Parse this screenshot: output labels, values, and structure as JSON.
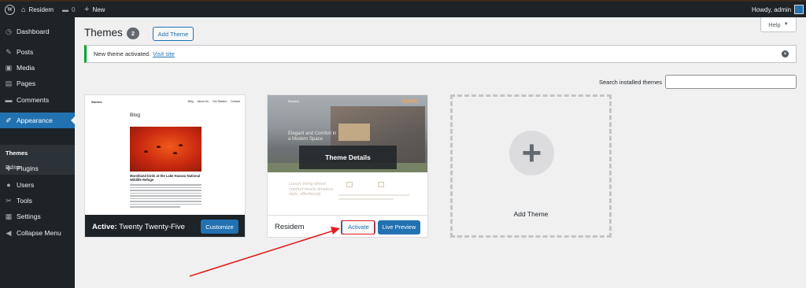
{
  "admin_bar": {
    "site_name": "Residem",
    "comments_count": "0",
    "new_label": "New",
    "greeting": "Howdy, admin"
  },
  "sidebar": {
    "items": [
      {
        "label": "Dashboard",
        "icon": "dashboard-icon",
        "glyph": "◷"
      },
      {
        "label": "Posts",
        "icon": "pin-icon",
        "glyph": "✎"
      },
      {
        "label": "Media",
        "icon": "media-icon",
        "glyph": "▣"
      },
      {
        "label": "Pages",
        "icon": "pages-icon",
        "glyph": "▤"
      },
      {
        "label": "Comments",
        "icon": "comment-icon",
        "glyph": "▬"
      },
      {
        "label": "Appearance",
        "icon": "brush-icon",
        "glyph": "✐"
      },
      {
        "label": "Plugins",
        "icon": "plugin-icon",
        "glyph": "✚"
      },
      {
        "label": "Users",
        "icon": "users-icon",
        "glyph": "●"
      },
      {
        "label": "Tools",
        "icon": "wrench-icon",
        "glyph": "✂"
      },
      {
        "label": "Settings",
        "icon": "settings-icon",
        "glyph": "▦"
      },
      {
        "label": "Collapse Menu",
        "icon": "collapse-icon",
        "glyph": "◀"
      }
    ],
    "submenu": [
      {
        "label": "Themes"
      },
      {
        "label": "Editor"
      }
    ]
  },
  "help_label": "Help",
  "page": {
    "title": "Themes",
    "theme_count": "2",
    "add_theme_label": "Add Theme"
  },
  "notice": {
    "text": "New theme activated.",
    "link": "Visit site"
  },
  "search": {
    "label": "Search installed themes",
    "value": ""
  },
  "themes": {
    "active": {
      "prefix": "Active:",
      "name": "Twenty Twenty-Five",
      "customize_label": "Customize",
      "screenshot": {
        "site_title": "Stories",
        "nav": [
          "Blog",
          "About Us",
          "Get Started",
          "Contact"
        ],
        "heading": "Blog",
        "post_title": "Marshland birds at the Lake Havasu National Wildlife Refuge"
      }
    },
    "residem": {
      "name": "Residem",
      "details_label": "Theme Details",
      "activate_label": "Activate",
      "live_preview_label": "Live Preview",
      "screenshot": {
        "logo": "Residem",
        "hero_heading": "Elegant and Comfort in a Modern Space",
        "lower_text": "Luxury living where comfort meets timeless style, effortlessly"
      }
    }
  },
  "add_new_theme_label": "Add Theme",
  "colors": {
    "accent": "#2271b1",
    "annotation": "#e02020",
    "success": "#00a32a",
    "admin_bar": "#1d2327"
  }
}
